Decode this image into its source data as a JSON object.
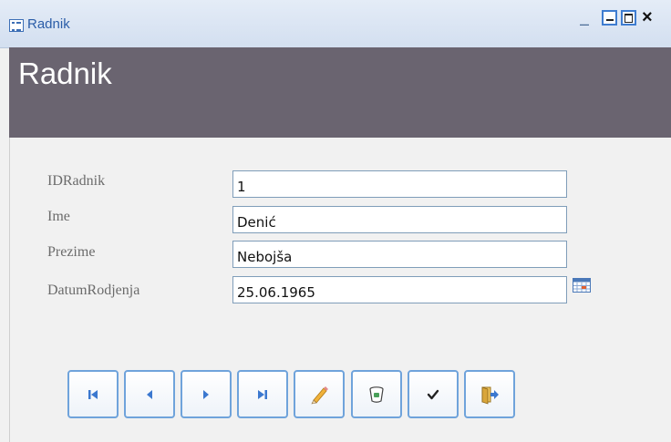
{
  "window": {
    "title": "Radnik",
    "controls": {
      "minimize_dash": "–"
    }
  },
  "form": {
    "title": "Radnik",
    "fields": [
      {
        "label": "IDRadnik",
        "value": "1"
      },
      {
        "label": "Ime",
        "value": "Denić"
      },
      {
        "label": "Prezime",
        "value": "Nebojša"
      },
      {
        "label": "DatumRodjenja",
        "value": "25.06.1965"
      }
    ]
  },
  "toolbar": {
    "buttons": [
      {
        "icon": "first-record-icon"
      },
      {
        "icon": "previous-record-icon"
      },
      {
        "icon": "next-record-icon"
      },
      {
        "icon": "last-record-icon"
      },
      {
        "icon": "edit-pencil-icon"
      },
      {
        "icon": "delete-bin-icon"
      },
      {
        "icon": "save-check-icon"
      },
      {
        "icon": "exit-door-icon"
      }
    ]
  },
  "colors": {
    "header_bg": "#6a6470",
    "title_text": "#ffffff",
    "window_title": "#2b5da8",
    "button_border": "#6fa3db",
    "nav_icon": "#3b78cf"
  }
}
